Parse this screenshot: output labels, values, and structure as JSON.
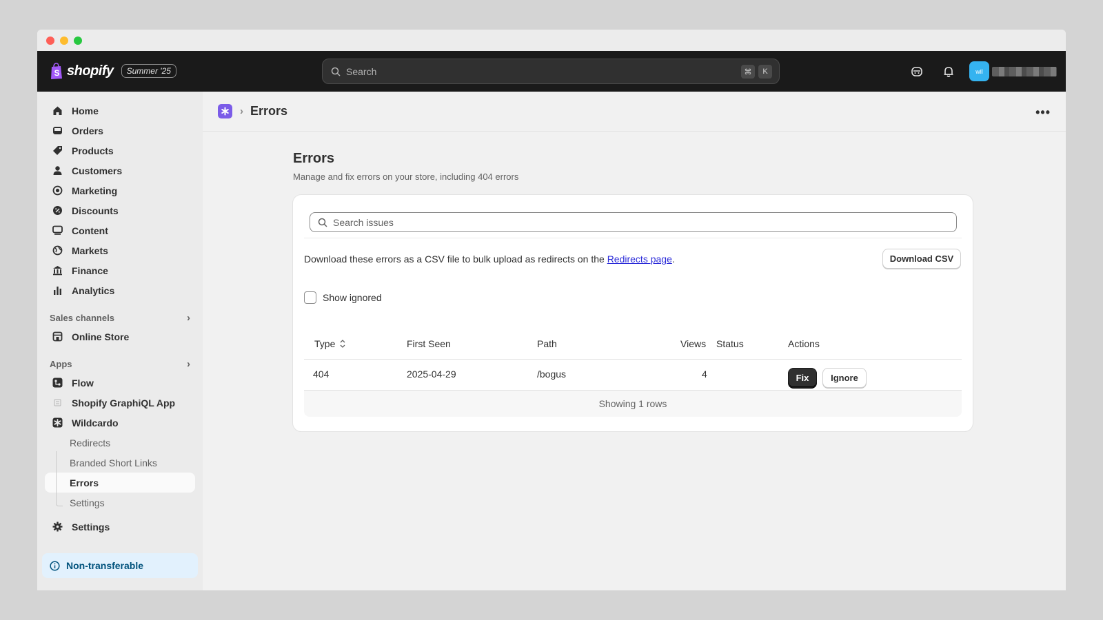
{
  "topbar": {
    "brand": "shopify",
    "edition": "Summer '25",
    "search_placeholder": "Search",
    "shortcut_cmd": "⌘",
    "shortcut_key": "K",
    "avatar_initials": "wil"
  },
  "sidebar": {
    "items": [
      {
        "label": "Home",
        "icon": "home-icon"
      },
      {
        "label": "Orders",
        "icon": "inbox-icon"
      },
      {
        "label": "Products",
        "icon": "tag-icon"
      },
      {
        "label": "Customers",
        "icon": "person-icon"
      },
      {
        "label": "Marketing",
        "icon": "target-icon"
      },
      {
        "label": "Discounts",
        "icon": "discount-icon"
      },
      {
        "label": "Content",
        "icon": "content-icon"
      },
      {
        "label": "Markets",
        "icon": "globe-icon"
      },
      {
        "label": "Finance",
        "icon": "bank-icon"
      },
      {
        "label": "Analytics",
        "icon": "chart-bar-icon"
      }
    ],
    "sales_channels_label": "Sales channels",
    "online_store": "Online Store",
    "apps_label": "Apps",
    "apps": [
      {
        "label": "Flow"
      },
      {
        "label": "Shopify GraphiQL App"
      },
      {
        "label": "Wildcardo"
      }
    ],
    "wildcardo_sub": [
      "Redirects",
      "Branded Short Links",
      "Errors",
      "Settings"
    ],
    "settings": "Settings",
    "nontransferable": "Non-transferable"
  },
  "breadcrumb": {
    "current": "Errors"
  },
  "page": {
    "title": "Errors",
    "subtitle": "Manage and fix errors on your store, including 404 errors",
    "search_placeholder": "Search issues",
    "csv_text_before": "Download these errors as a CSV file to bulk upload as redirects on the ",
    "csv_link": "Redirects page",
    "csv_text_after": ".",
    "download_label": "Download CSV",
    "show_ignored": "Show ignored",
    "columns": [
      "Type",
      "First Seen",
      "Path",
      "Views",
      "Status",
      "Actions"
    ],
    "rows": [
      {
        "type": "404",
        "first_seen": "2025-04-29",
        "path": "/bogus",
        "views": "4",
        "status": ""
      }
    ],
    "fix_label": "Fix",
    "ignore_label": "Ignore",
    "footer": "Showing 1 rows"
  },
  "colors": {
    "accent_app": "#7b5ce8",
    "topbar": "#1a1a1a",
    "link": "#2a2ad8",
    "info_bg": "#e2f1fd"
  }
}
